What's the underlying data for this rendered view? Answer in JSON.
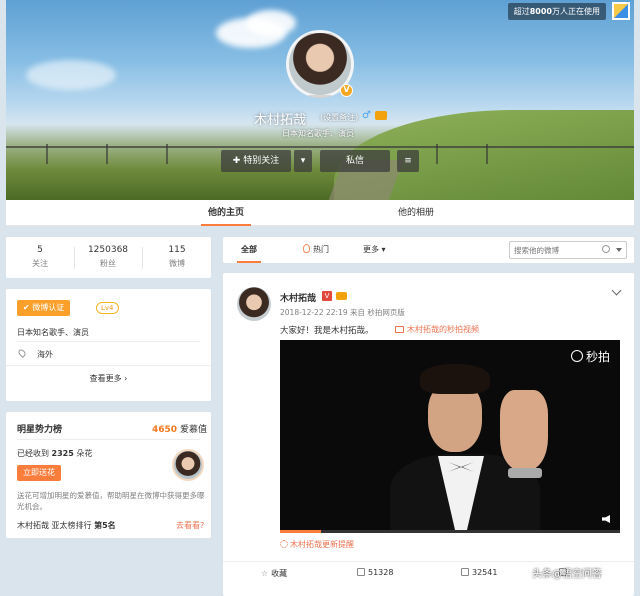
{
  "cover": {
    "watch_prefix": "超过",
    "watch_count": "8000",
    "watch_suffix": "万人正在使用",
    "name": "木村拓哉",
    "remark": "(设置备注)",
    "male_symbol": "♂",
    "description": "日本知名歌手、演员",
    "follow_button": "✚ 特别关注",
    "more_button": "▾",
    "message_button": "私信",
    "menu_button": "≡",
    "avatar_badge": "V"
  },
  "tabs": {
    "home": "他的主页",
    "album": "他的相册"
  },
  "stats": [
    {
      "num": "5",
      "label": "关注"
    },
    {
      "num": "1250368",
      "label": "粉丝"
    },
    {
      "num": "115",
      "label": "微博"
    }
  ],
  "info": {
    "cert_label": "✔ 微博认证",
    "level": "Lv4",
    "desc": "日本知名歌手、演员",
    "location": "海外",
    "view_more": "查看更多 ›"
  },
  "power": {
    "title": "明星势力榜",
    "value": "4650",
    "value_unit": "爱慕值",
    "received_prefix": "已经收到",
    "received_count": "2325",
    "received_suffix": "朵花",
    "send_button": "立即送花",
    "note": "送花可增加明星的爱慕值，帮助明星在微博中获得更多曝光机会。",
    "rank_prefix": "木村拓哉 亚太榜排行",
    "rank_value": "第5名",
    "see_link": "去看看?"
  },
  "filter": {
    "all": "全部",
    "hot": "热门",
    "more": "更多 ▾",
    "search_placeholder": "搜索他的微博"
  },
  "post": {
    "author": "木村拓哉",
    "v_badge": "V",
    "meta": "2018-12-22 22:19 来自 秒拍网页版",
    "text": "大家好！我是木村拓哉。",
    "video_link": "木村拓哉的秒拍视频",
    "video_logo": "秒拍",
    "video_progress": 0.12,
    "reminder": "木村拓哉更新提醒",
    "actions": {
      "favorite": "收藏",
      "share": "51328",
      "comment": "32541",
      "like": ""
    }
  },
  "watermark": "头条@悟空问答",
  "colors": {
    "accent": "#fa7d3c",
    "link": "#eb7350",
    "bg": "#d9e4ec"
  }
}
